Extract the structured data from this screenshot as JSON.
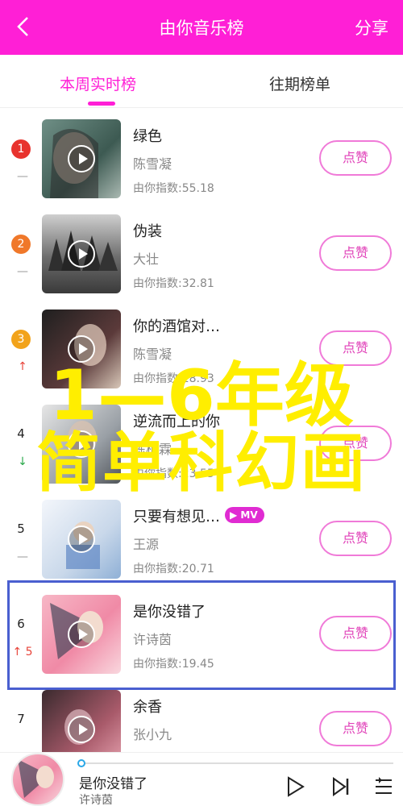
{
  "header": {
    "title": "由你音乐榜",
    "share_label": "分享",
    "accent_color": "#ff1fd6"
  },
  "tabs": [
    {
      "label": "本周实时榜",
      "active": true
    },
    {
      "label": "往期榜单",
      "active": false
    }
  ],
  "songs": [
    {
      "rank": "1",
      "badge_color": "#e8332e",
      "trend": "—",
      "title": "绿色",
      "artist": "陈雪凝",
      "index_label": "由你指数:55.18",
      "like_label": "点赞",
      "cover_icon": "cover-art-woman-closed-eyes"
    },
    {
      "rank": "2",
      "badge_color": "#f0782a",
      "trend": "—",
      "title": "伪装",
      "artist": "大壮",
      "index_label": "由你指数:32.81",
      "like_label": "点赞",
      "cover_icon": "cover-art-forest"
    },
    {
      "rank": "3",
      "badge_color": "#f2a31b",
      "trend": "↑",
      "title": "你的酒馆对…",
      "artist": "陈雪凝",
      "index_label": "由你指数:28.93",
      "like_label": "点赞",
      "cover_icon": "cover-art-dark-portrait"
    },
    {
      "rank": "4",
      "trend": "↓",
      "title": "逆流而上的你",
      "artist": "陈柏霖",
      "index_label": "由你指数:23.55",
      "like_label": "点赞",
      "cover_icon": "cover-art-portrait"
    },
    {
      "rank": "5",
      "trend": "—",
      "title": "只要有想见…",
      "mv_label": "MV",
      "artist": "王源",
      "index_label": "由你指数:20.71",
      "like_label": "点赞",
      "cover_icon": "cover-art-boy-reading"
    },
    {
      "rank": "6",
      "trend": "↑ 5",
      "title": "是你没错了",
      "artist": "许诗茵",
      "index_label": "由你指数:19.45",
      "like_label": "点赞",
      "cover_icon": "cover-art-pink-girl"
    },
    {
      "rank": "7",
      "trend": "",
      "title": "余香",
      "artist": "张小九",
      "index_label": "",
      "like_label": "点赞",
      "cover_icon": "cover-art-pink-dark"
    }
  ],
  "overlay": {
    "line1": "1—6年级",
    "line2": "简单科幻画",
    "color": "#ffee00"
  },
  "player": {
    "song": "是你没错了",
    "artist": "许诗茵",
    "progress": 0.0,
    "controls": [
      "play-icon",
      "next-icon",
      "playlist-icon"
    ]
  }
}
